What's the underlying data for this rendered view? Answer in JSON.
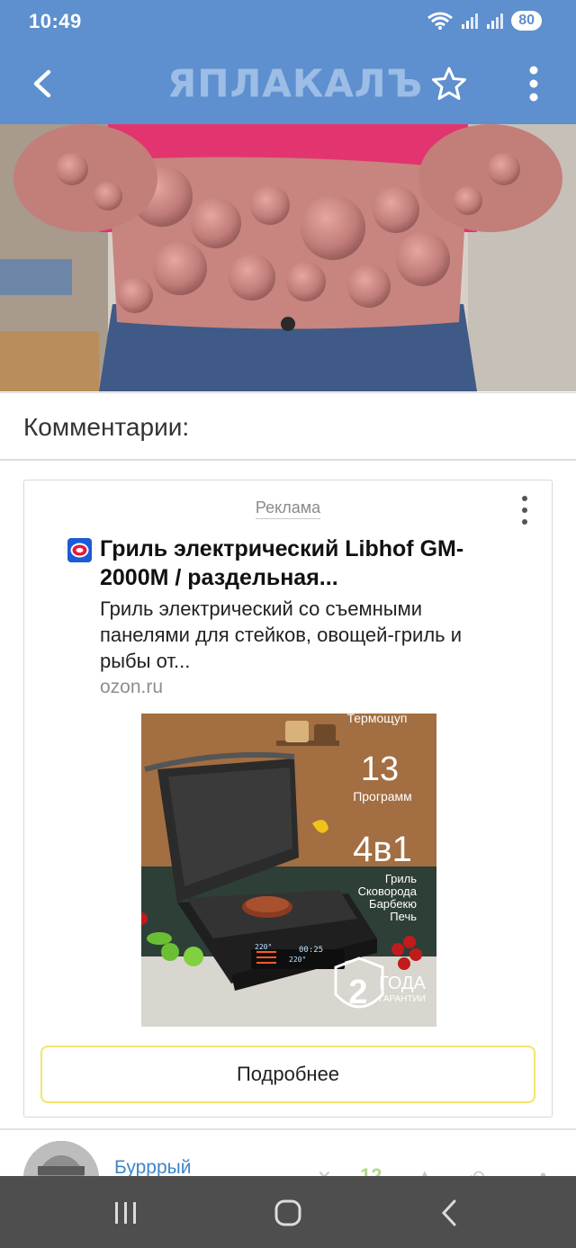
{
  "status_bar": {
    "time": "10:49",
    "battery": "80",
    "icons": [
      "wifi-icon",
      "signal-icon",
      "signal-icon"
    ]
  },
  "app_bar": {
    "logo": "ЯПЛАКАЛЪ",
    "icons": [
      "back-arrow-icon",
      "star-icon",
      "more-vertical-icon"
    ],
    "colors": {
      "background": "#5e8fce",
      "logo": "#9cbde6"
    }
  },
  "comments": {
    "heading": "Комментарии:"
  },
  "ad": {
    "label": "Реклама",
    "title": "Гриль электрический Libhof GM-2000M / раздельная...",
    "description": "Гриль электрический со съемными панелями для стейков, овощей-гриль и рыбы от...",
    "domain": "ozon.ru",
    "product_image": {
      "top_text": "Термощуп",
      "programs_number": "13",
      "programs_label": "Программ",
      "modes_number": "4в1",
      "modes": [
        "Гриль",
        "Сковорода",
        "Барбекю",
        "Печь"
      ],
      "warranty_number": "2",
      "warranty_line1": "ГОДА",
      "warranty_line2": "ГАРАНТИИ",
      "display_temp_1": "220°",
      "display_time": "00:25",
      "display_temp_2": "220°"
    },
    "button": "Подробнее",
    "colors": {
      "button_border": "#f2e56b",
      "brand": "#1a5bd6"
    }
  },
  "comment_row": {
    "author": "Бурррый",
    "score": "12"
  },
  "nav_bar": {
    "icons": [
      "recent-apps-icon",
      "home-icon",
      "back-icon"
    ]
  }
}
